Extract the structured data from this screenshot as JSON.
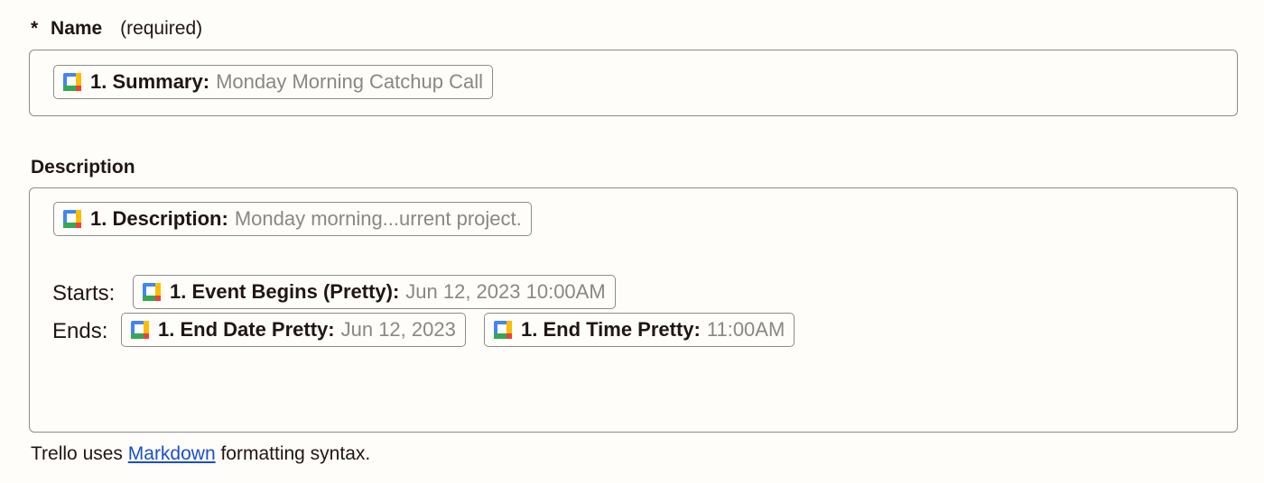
{
  "name_field": {
    "asterisk": "*",
    "label": "Name",
    "required_text": "(required)",
    "pill": {
      "key": "1. Summary:",
      "value": "Monday Morning Catchup Call",
      "icon": "google-calendar-icon"
    }
  },
  "description_field": {
    "label": "Description",
    "description_pill": {
      "key": "1. Description:",
      "value": "Monday morning...urrent project.",
      "icon": "google-calendar-icon"
    },
    "starts_label": "Starts:",
    "starts_pill": {
      "key": "1. Event Begins (Pretty):",
      "value": "Jun 12, 2023 10:00AM",
      "icon": "google-calendar-icon"
    },
    "ends_label": "Ends:",
    "end_date_pill": {
      "key": "1. End Date Pretty:",
      "value": "Jun 12, 2023",
      "icon": "google-calendar-icon"
    },
    "end_time_pill": {
      "key": "1. End Time Pretty:",
      "value": "11:00AM",
      "icon": "google-calendar-icon"
    }
  },
  "help_text": {
    "before": "Trello uses ",
    "link": "Markdown",
    "after": " formatting syntax."
  }
}
